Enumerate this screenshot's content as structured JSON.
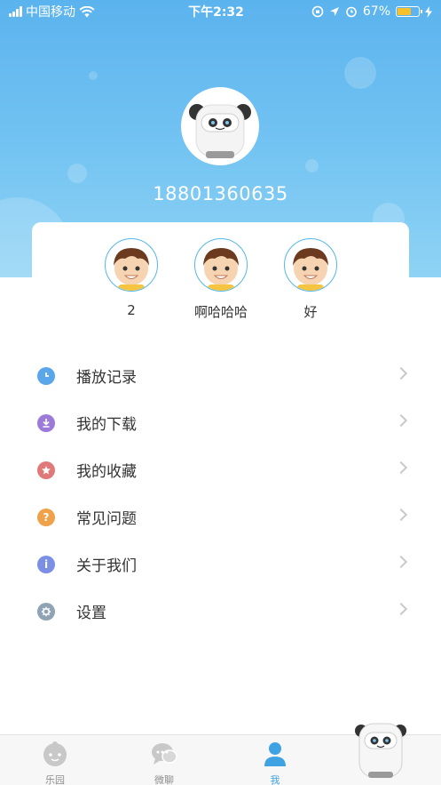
{
  "status_bar": {
    "carrier": "中国移动",
    "time": "下午2:32",
    "battery_percent": "67%",
    "battery_level": 0.67
  },
  "profile": {
    "phone": "18801360635"
  },
  "children": [
    {
      "name": "2"
    },
    {
      "name": "啊哈哈哈"
    },
    {
      "name": "好"
    }
  ],
  "menu": [
    {
      "label": "播放记录",
      "icon": "clock-icon",
      "color": "#5aa6ea"
    },
    {
      "label": "我的下载",
      "icon": "download-icon",
      "color": "#9b7ad8"
    },
    {
      "label": "我的收藏",
      "icon": "star-icon",
      "color": "#e07a7a"
    },
    {
      "label": "常见问题",
      "icon": "question-icon",
      "color": "#f0a24a"
    },
    {
      "label": "关于我们",
      "icon": "info-icon",
      "color": "#7b8fe6"
    },
    {
      "label": "设置",
      "icon": "gear-icon",
      "color": "#8fa3b5"
    }
  ],
  "tabs": [
    {
      "label": "乐园",
      "icon": "baby-face-icon",
      "active": false
    },
    {
      "label": "微聊",
      "icon": "chat-bubbles-icon",
      "active": false
    },
    {
      "label": "我",
      "icon": "person-icon",
      "active": true
    }
  ],
  "colors": {
    "header_top": "#5bb3ee",
    "header_bottom": "#8fd3f5",
    "accent": "#3fa3e3"
  }
}
